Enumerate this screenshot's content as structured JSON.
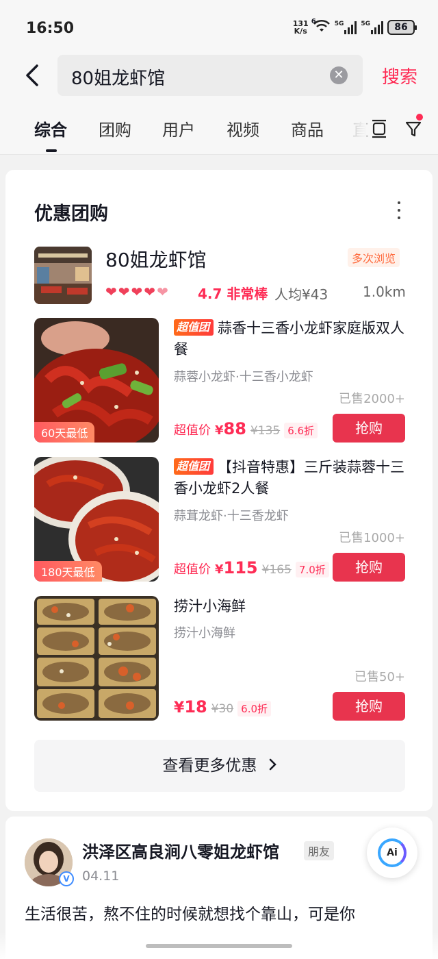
{
  "status": {
    "time": "16:50",
    "net_speed_value": "131",
    "net_speed_unit": "K/s",
    "wifi_tag": "6",
    "sig1_tag": "5G",
    "sig2_tag": "5G",
    "battery": "86"
  },
  "search": {
    "query": "80姐龙虾馆",
    "clear_icon": "clear-icon",
    "submit_label": "搜索"
  },
  "tabs": [
    {
      "label": "综合",
      "active": true
    },
    {
      "label": "团购"
    },
    {
      "label": "用户"
    },
    {
      "label": "视频"
    },
    {
      "label": "商品"
    },
    {
      "label": "直"
    }
  ],
  "deals_card": {
    "title": "优惠团购",
    "shop": {
      "name": "80姐龙虾馆",
      "badge": "多次浏览",
      "hearts": 4.5,
      "rating": "4.7 非常棒",
      "avg_price": "人均¥43",
      "distance": "1.0km"
    },
    "deals": [
      {
        "tag": "60天最低",
        "label": "超值团",
        "title": "蒜香十三香小龙虾家庭版双人餐",
        "subtitle": "蒜蓉小龙虾·十三香小龙虾",
        "sold": "已售2000+",
        "price_prefix": "超值价",
        "price_yen": "¥",
        "price": "88",
        "original": "¥135",
        "discount": "6.6折",
        "button": "抢购"
      },
      {
        "tag": "180天最低",
        "label": "超值团",
        "title": "【抖音特惠】三斤装蒜蓉十三香小龙虾2人餐",
        "subtitle": "蒜茸龙虾·十三香龙虾",
        "sold": "已售1000+",
        "price_prefix": "超值价",
        "price_yen": "¥",
        "price": "115",
        "original": "¥165",
        "discount": "7.0折",
        "button": "抢购"
      },
      {
        "title": "捞汁小海鲜",
        "subtitle": "捞汁小海鲜",
        "sold": "已售50+",
        "price_yen": "¥",
        "price": "18",
        "original": "¥30",
        "discount": "6.0折",
        "button": "抢购"
      }
    ],
    "see_more": "查看更多优惠"
  },
  "post": {
    "author": "洪泽区高良涧八零姐龙虾馆",
    "relation": "朋友",
    "date": "04.11",
    "verified_mark": "V",
    "text": "生活很苦，熬不住的时候就想找个靠山，可是你"
  },
  "ai_button": "Ai",
  "colors": {
    "accent": "#fe2c55",
    "buy_button": "#e8344e",
    "page_bg": "#f2f2f2"
  }
}
